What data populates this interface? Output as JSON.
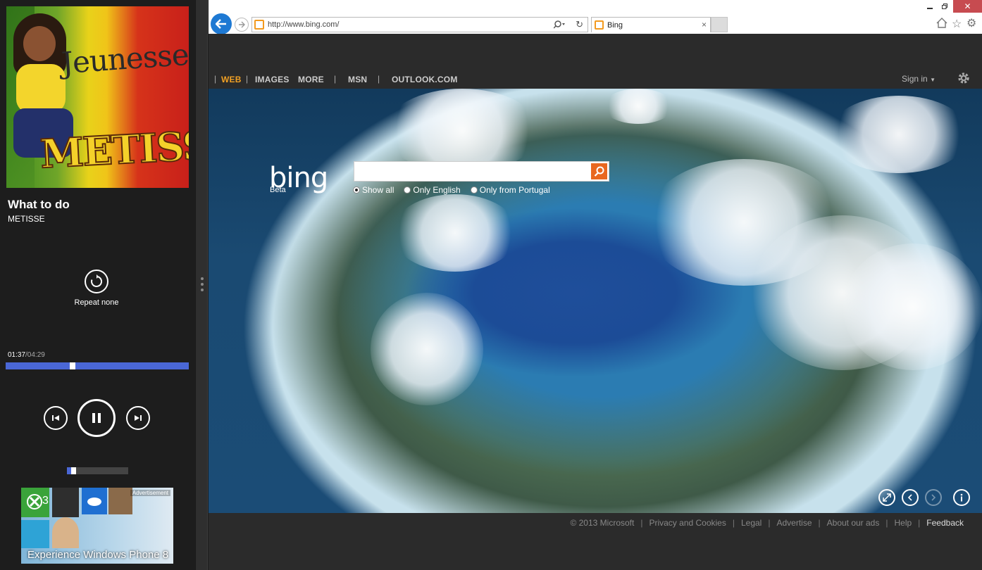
{
  "music": {
    "album_art": {
      "word1": "Jeunesse",
      "word2": "METISSE"
    },
    "track_title": "What to do",
    "artist": "METISSE",
    "repeat_label": "Repeat none",
    "time_elapsed": "01:37",
    "time_total": "/04:29",
    "progress_fraction": 0.36,
    "volume_fraction": 0.08,
    "ad": {
      "tag": "Advertisement",
      "text": "Experience Windows Phone 8",
      "tile_number": "3"
    },
    "icons": {
      "repeat": "repeat-icon",
      "prev": "previous-track-icon",
      "pause": "pause-icon",
      "next": "next-track-icon"
    }
  },
  "browser": {
    "address_url": "http://www.bing.com/",
    "tab_title": "Bing",
    "tab_close": "×",
    "window_close": "✕",
    "icons": {
      "back": "back-arrow-icon",
      "forward": "forward-arrow-icon",
      "home": "home-icon",
      "favorites": "star-icon",
      "tools": "gear-icon"
    }
  },
  "bing": {
    "nav": {
      "web": "WEB",
      "images": "IMAGES",
      "more": "MORE",
      "msn": "MSN",
      "outlook": "OUTLOOK.COM",
      "sep": "|",
      "sign_in": "Sign in"
    },
    "logo": "bing",
    "beta": "Beta",
    "scope_options": [
      "Show all",
      "Only English",
      "Only from Portugal"
    ],
    "accent_color": "#e9671f",
    "footer": {
      "copyright": "© 2013 Microsoft",
      "privacy": "Privacy and Cookies",
      "legal": "Legal",
      "advertise": "Advertise",
      "about": "About our ads",
      "help": "Help",
      "feedback": "Feedback",
      "sep": "|"
    }
  }
}
